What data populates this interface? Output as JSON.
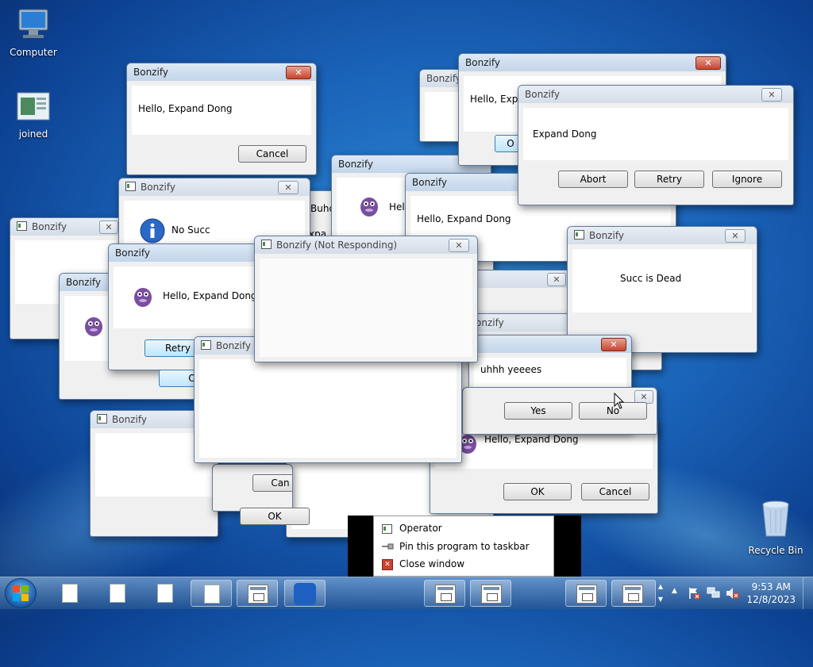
{
  "desktop": {
    "icons": [
      {
        "label": "Computer",
        "icon": "computer-icon"
      },
      {
        "label": "joined",
        "icon": "image-file-icon"
      },
      {
        "label": "Recycle Bin",
        "icon": "recycle-bin-icon"
      }
    ]
  },
  "windows": {
    "w1": {
      "title": "Bonzify",
      "message": "Hello, Expand Dong",
      "cancel": "Cancel"
    },
    "w2": {
      "title": "Bonzify",
      "message": "No Succ"
    },
    "w3": {
      "title": "Bonzify"
    },
    "w4": {
      "title": "Bonzify"
    },
    "w5": {
      "title": "Bonzify",
      "message": "Hello, Expand Dong",
      "retry": "Retry",
      "ok_partial": "O"
    },
    "w6": {
      "title": "Bonzify"
    },
    "w7": {
      "title": "Bonzify",
      "message_partial": "Hell"
    },
    "w8": {
      "title": "Bonzify",
      "message": "Hello, Expand Dong"
    },
    "w9": {
      "title": "Bonzify (Not Responding)"
    },
    "w10": {
      "title": "Bonzify (",
      "cancel_partial": "Can",
      "ok": "OK"
    },
    "w11": {
      "title": "Bonzify",
      "message": "Succ is Dead"
    },
    "w12": {
      "title": "Bonzify",
      "message_partial": "Hello, Expan",
      "btn_partial": "O"
    },
    "w13": {
      "title": "Bonzify",
      "message": "Expand Dong",
      "abort": "Abort",
      "retry": "Retry",
      "ignore": "Ignore"
    },
    "w14": {
      "message": "uhhh yeeees",
      "yes": "Yes",
      "no": "No"
    },
    "w15": {
      "message": "Hello, Expand Dong",
      "ok": "OK",
      "cancel": "Cancel"
    },
    "w16": {
      "title": "Bonzify"
    },
    "w17": {
      "title_partial": "onzify"
    },
    "w18": {
      "title": "Bonzify",
      "message_partial": "Buhd",
      "partial2": "xpa"
    },
    "w19": {
      "title_partial": "Bo"
    },
    "w20": {
      "title": "Bonzify"
    }
  },
  "context_menu": {
    "items": [
      {
        "label": "Operator",
        "icon": "app-icon"
      },
      {
        "label": "Pin this program to taskbar",
        "icon": "pin-icon"
      },
      {
        "label": "Close window",
        "icon": "close-window-icon"
      }
    ]
  },
  "taskbar": {
    "start_icon": "windows-start-icon",
    "clock_time": "9:53 AM",
    "clock_date": "12/8/2023",
    "tray_icons": [
      "show-hidden-icons-arrow",
      "action-center-icon",
      "network-icon",
      "volume-muted-icon"
    ]
  },
  "colors": {
    "close_button": "#c7452f",
    "desktop_blue": "#1a63b8"
  }
}
